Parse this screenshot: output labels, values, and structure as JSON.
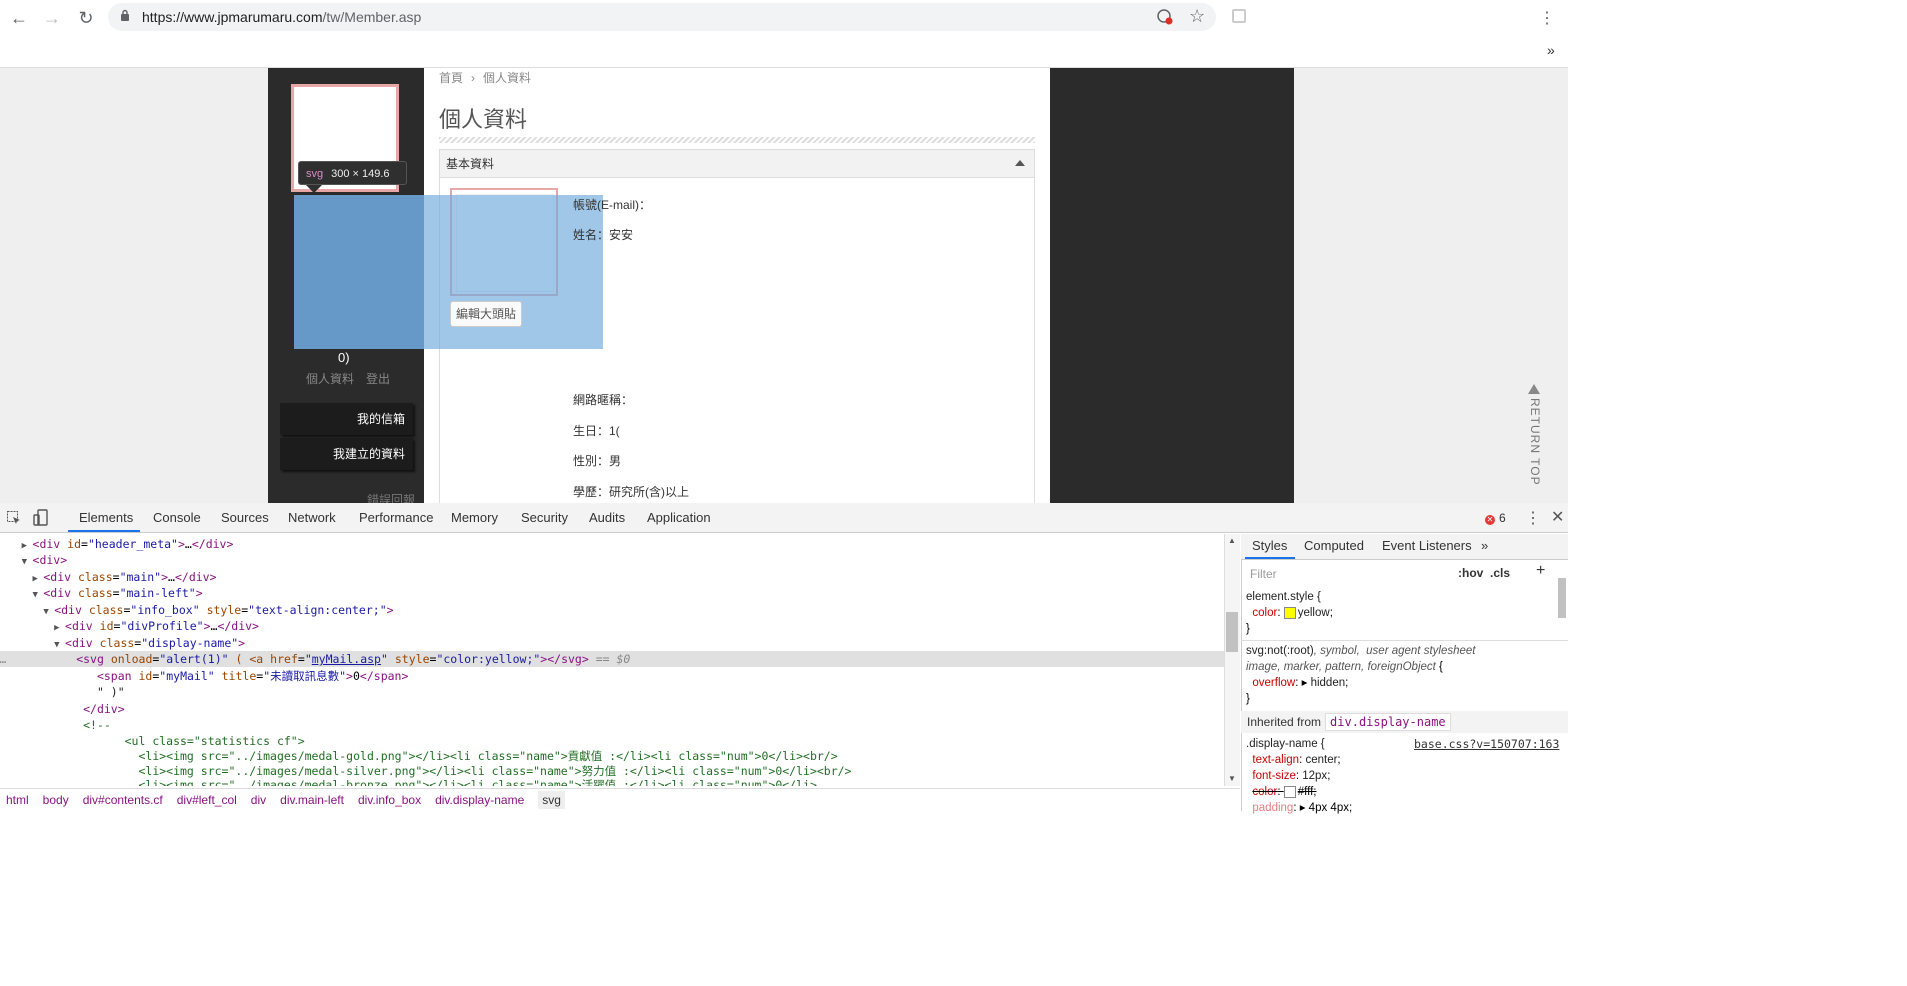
{
  "browser": {
    "url_host": "https://www.jpmarumaru.com",
    "url_path": "/tw/Member.asp"
  },
  "page": {
    "breadcrumb_home": "首頁",
    "breadcrumb_current": "個人資料",
    "title": "個人資料",
    "panel_title": "基本資料",
    "edit_avatar": "編輯大頭貼",
    "fields": {
      "account": "帳號(E-mail)：",
      "name": "姓名：安安",
      "nickname": "網路暱稱：",
      "birthday": "生日：1(",
      "gender": "性別：男",
      "education": "學歷：研究所(含)以上"
    },
    "left": {
      "count_text": "0)",
      "link_profile": "個人資料",
      "link_logout": "登出",
      "menu_mail": "我的信箱",
      "menu_created": "我建立的資料",
      "report": "錯誤回報"
    },
    "tooltip_tag": "svg",
    "tooltip_dim": "300 × 149.6",
    "return_top": "RETURN TOP"
  },
  "devtools": {
    "tabs": [
      "Elements",
      "Console",
      "Sources",
      "Network",
      "Performance",
      "Memory",
      "Security",
      "Audits",
      "Application"
    ],
    "error_count": "6",
    "styles_tabs": [
      "Styles",
      "Computed",
      "Event Listeners"
    ],
    "filter_placeholder": "Filter",
    "hov": ":hov",
    "cls": ".cls",
    "breadcrumbs": [
      "html",
      "body",
      "div#contents.cf",
      "div#left_col",
      "div",
      "div.main-left",
      "div.info_box",
      "div.display-name",
      "svg"
    ],
    "inherited_from": "Inherited from",
    "inherited_tag": "div.display-name",
    "source_link": "base.css?v=150707:163"
  }
}
